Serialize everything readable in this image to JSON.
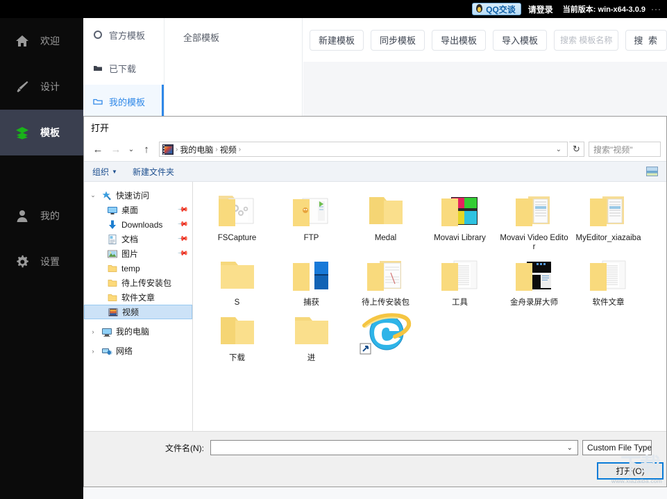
{
  "topbar": {
    "qq_label": "QQ交谈",
    "login_label": "请登录",
    "version_label": "当前版本: win-x64-3.0.9",
    "more_label": "···"
  },
  "app_sidebar": {
    "items": [
      {
        "label": "欢迎",
        "icon": "home-icon",
        "active": false
      },
      {
        "label": "设计",
        "icon": "brush-icon",
        "active": false
      },
      {
        "label": "模板",
        "icon": "layers-icon",
        "active": true
      },
      {
        "label": "我的",
        "icon": "user-icon",
        "active": false
      },
      {
        "label": "设置",
        "icon": "gear-icon",
        "active": false
      }
    ]
  },
  "template_panel": {
    "categories": [
      {
        "label": "官方模板",
        "icon": "circle-icon",
        "active": false
      },
      {
        "label": "已下载",
        "icon": "folder-filled-icon",
        "active": false
      },
      {
        "label": "我的模板",
        "icon": "folder-outline-icon",
        "active": true
      }
    ],
    "middle_label": "全部模板",
    "toolbar_buttons": [
      "新建模板",
      "同步模板",
      "导出模板",
      "导入模板"
    ],
    "search_placeholder": "搜索 模板名称",
    "search_button": "搜 索"
  },
  "dialog": {
    "title": "打开",
    "nav": {
      "back": "←",
      "forward": "→",
      "recent": "⌄",
      "up": "↑"
    },
    "breadcrumbs": [
      "我的电脑",
      "视频"
    ],
    "address_caret": "⌄",
    "refresh_icon": "↻",
    "search_placeholder": "搜索\"视频\"",
    "command_bar": {
      "organize": "组织",
      "organize_caret": "▼",
      "new_folder": "新建文件夹",
      "view_icon": "view-icon"
    },
    "tree": [
      {
        "label": "快速访问",
        "icon": "star-pin-icon",
        "twisty": "⌄",
        "level": 0,
        "selected": false,
        "pinned": false
      },
      {
        "label": "桌面",
        "icon": "desktop-icon",
        "twisty": "",
        "level": 1,
        "selected": false,
        "pinned": true
      },
      {
        "label": "Downloads",
        "icon": "download-icon",
        "twisty": "",
        "level": 1,
        "selected": false,
        "pinned": true
      },
      {
        "label": "文档",
        "icon": "document-icon",
        "twisty": "",
        "level": 1,
        "selected": false,
        "pinned": true
      },
      {
        "label": "图片",
        "icon": "picture-icon",
        "twisty": "",
        "level": 1,
        "selected": false,
        "pinned": true
      },
      {
        "label": "temp",
        "icon": "folder-icon",
        "twisty": "",
        "level": 1,
        "selected": false,
        "pinned": false
      },
      {
        "label": "待上传安装包",
        "icon": "folder-icon",
        "twisty": "",
        "level": 1,
        "selected": false,
        "pinned": false
      },
      {
        "label": "软件文章",
        "icon": "folder-icon",
        "twisty": "",
        "level": 1,
        "selected": false,
        "pinned": false
      },
      {
        "label": "视频",
        "icon": "video-folder-icon",
        "twisty": "",
        "level": 1,
        "selected": true,
        "pinned": false
      },
      {
        "label": "我的电脑",
        "icon": "computer-icon",
        "twisty": "›",
        "level": 0,
        "selected": false,
        "pinned": false
      },
      {
        "label": "网络",
        "icon": "network-icon",
        "twisty": "›",
        "level": 0,
        "selected": false,
        "pinned": false
      }
    ],
    "files": [
      {
        "name": "FSCapture",
        "type": "folder-docs"
      },
      {
        "name": "FTP",
        "type": "folder-docs"
      },
      {
        "name": "Medal",
        "type": "folder-empty"
      },
      {
        "name": "Movavi Library",
        "type": "folder-colorful"
      },
      {
        "name": "Movavi Video Editor",
        "type": "folder-docs"
      },
      {
        "name": "MyEditor_xiazaiba",
        "type": "folder-docs"
      },
      {
        "name": "S",
        "type": "folder-empty"
      },
      {
        "name": "捕获",
        "type": "folder-blue"
      },
      {
        "name": "待上传安装包",
        "type": "folder-docs"
      },
      {
        "name": "工具",
        "type": "folder-docs"
      },
      {
        "name": "金舟录屏大师",
        "type": "folder-dark"
      },
      {
        "name": "软件文章",
        "type": "folder-docs"
      },
      {
        "name": "下载",
        "type": "folder-empty"
      },
      {
        "name": "进",
        "type": "folder-empty"
      },
      {
        "name": "",
        "type": "ie-shortcut"
      }
    ],
    "footer": {
      "filename_label": "文件名(N):",
      "filename_value": "",
      "filename_caret": "⌄",
      "filetype_value": "Custom File Type",
      "open_button": "打开(O)"
    }
  },
  "watermark": {
    "url": "www.xiazaiba.com",
    "glyph": "下载"
  },
  "colors": {
    "accent_blue": "#2f88e8",
    "selection_blue": "#cce2f7",
    "open_border": "#0a7cd8",
    "folder_yellow": "#fbe08a",
    "sidebar_active": "#3a3f4f",
    "topbar_black": "#000000",
    "green_icon": "#19b319"
  }
}
